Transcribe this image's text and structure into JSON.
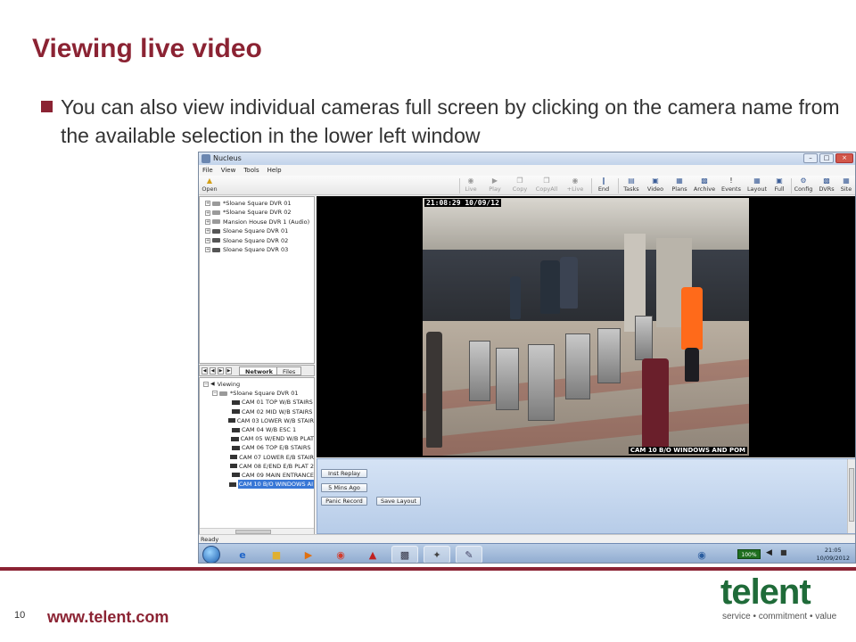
{
  "slide": {
    "title": "Viewing live video",
    "bullet": "You can also view individual cameras full screen by clicking on the camera name from the available selection in the lower left window",
    "page_number": "10",
    "url": "www.telent.com",
    "logo_word": "telent",
    "logo_tagline": "service • commitment • value",
    "colors": {
      "accent": "#8b2333",
      "logo_green": "#1f6b39"
    }
  },
  "app": {
    "window_title": "Nucleus",
    "window_buttons": [
      "–",
      "□",
      "×"
    ],
    "menu": [
      "File",
      "View",
      "Tools",
      "Help"
    ],
    "toolbar": {
      "open": "Open",
      "live": "Live",
      "play": "Play",
      "copy": "Copy",
      "copyall": "CopyAll",
      "pluslive": "+Live",
      "end": "End",
      "tasks": "Tasks",
      "video": "Video",
      "plans": "Plans",
      "archive": "Archive",
      "events": "Events",
      "layout": "Layout",
      "full": "Full",
      "config": "Config",
      "dvrs": "DVRs",
      "site": "Site"
    },
    "dvr_tree": [
      "*Sloane Square DVR 01",
      "*Sloane Square DVR 02",
      "Mansion House DVR 1 (Audio)",
      "Sloane Square DVR 01",
      "Sloane Square DVR 02",
      "Sloane Square DVR 03"
    ],
    "tabs": {
      "network": "Network",
      "files": "Files"
    },
    "viewing_tree": {
      "root": "Viewing",
      "dvr": "*Sloane Square DVR 01",
      "cameras": [
        "CAM 01 TOP W/B STAIRS",
        "CAM 02 MID W/B STAIRS",
        "CAM 03 LOWER W/B STAIR",
        "CAM 04 W/B ESC 1",
        "CAM 05 W/END W/B PLAT",
        "CAM 06 TOP E/B STAIRS",
        "CAM 07 LOWER E/B STAIR",
        "CAM 08 E/END E/B PLAT 2",
        "CAM 09 MAIN ENTRANCE",
        "CAM 10 B/O WINDOWS AI"
      ],
      "selected_index": 9
    },
    "video": {
      "timestamp": "21:08:29 10/09/12",
      "camera_label": "CAM 10 B/O WINDOWS AND POM"
    },
    "controls": {
      "inst_replay": "Inst Replay",
      "five_mins_ago": "5 Mins Ago",
      "panic_record": "Panic Record",
      "save_layout": "Save Layout"
    },
    "status": "Ready"
  },
  "taskbar": {
    "battery": "100%",
    "clock_time": "21:05",
    "clock_date": "10/09/2012"
  }
}
